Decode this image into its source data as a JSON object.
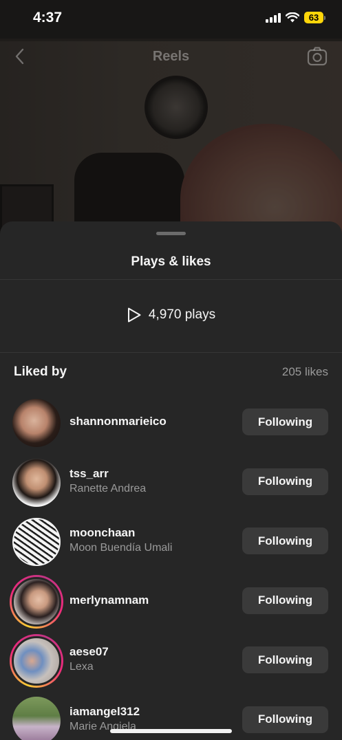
{
  "status_bar": {
    "time": "4:37",
    "battery": "63",
    "icons": [
      "signal-icon",
      "wifi-icon",
      "battery-icon"
    ]
  },
  "reels_header": {
    "title": "Reels",
    "icons": [
      "back-chevron-icon",
      "camera-icon"
    ]
  },
  "sheet": {
    "title": "Plays & likes",
    "plays": "4,970 plays",
    "play_icon": "play-icon",
    "liked_by_label": "Liked by",
    "likes_count": "205 likes"
  },
  "users": [
    {
      "username": "shannonmarieico",
      "fullname": "",
      "button": "Following",
      "story_ring": false
    },
    {
      "username": "tss_arr",
      "fullname": "Ranette Andrea",
      "button": "Following",
      "story_ring": false
    },
    {
      "username": "moonchaan",
      "fullname": "Moon Buendía Umali",
      "button": "Following",
      "story_ring": false
    },
    {
      "username": "merlynamnam",
      "fullname": "",
      "button": "Following",
      "story_ring": true
    },
    {
      "username": "aese07",
      "fullname": "Lexa",
      "button": "Following",
      "story_ring": true
    },
    {
      "username": "iamangel312",
      "fullname": "Marie Angiela",
      "button": "Following",
      "story_ring": false
    }
  ],
  "colors": {
    "sheet_bg": "#262626",
    "button_bg": "#3a3a3a",
    "secondary_text": "#9a9a9a",
    "battery": "#ffd60a"
  }
}
